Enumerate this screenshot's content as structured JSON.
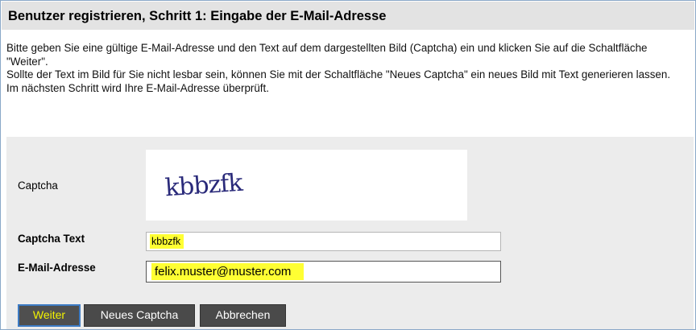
{
  "header": {
    "title": "Benutzer registrieren, Schritt 1: Eingabe der E-Mail-Adresse"
  },
  "intro": {
    "line1": "Bitte geben Sie eine gültige E-Mail-Adresse und den Text auf dem dargestellten Bild (Captcha) ein und klicken Sie auf die Schaltfläche \"Weiter\".",
    "line2": "Sollte der Text im Bild für Sie nicht lesbar sein, können Sie mit der Schaltfläche \"Neues Captcha\" ein neues Bild mit Text generieren lassen.",
    "line3": "Im nächsten Schritt wird Ihre E-Mail-Adresse überprüft."
  },
  "form": {
    "captcha_label": "Captcha",
    "captcha_image_text": "kbbzfk",
    "captcha_text_label": "Captcha Text",
    "captcha_text_value": "kbbzfk",
    "email_label": "E-Mail-Adresse",
    "email_value": "felix.muster@muster.com"
  },
  "buttons": {
    "weiter": "Weiter",
    "neues_captcha": "Neues Captcha",
    "abbrechen": "Abbrechen"
  },
  "colors": {
    "highlight": "#ffff33",
    "button_bg": "#4a4a4a",
    "panel_bg": "#ececec",
    "captcha_ink": "#2a2a7a",
    "focus_border": "#3d7bc4"
  }
}
